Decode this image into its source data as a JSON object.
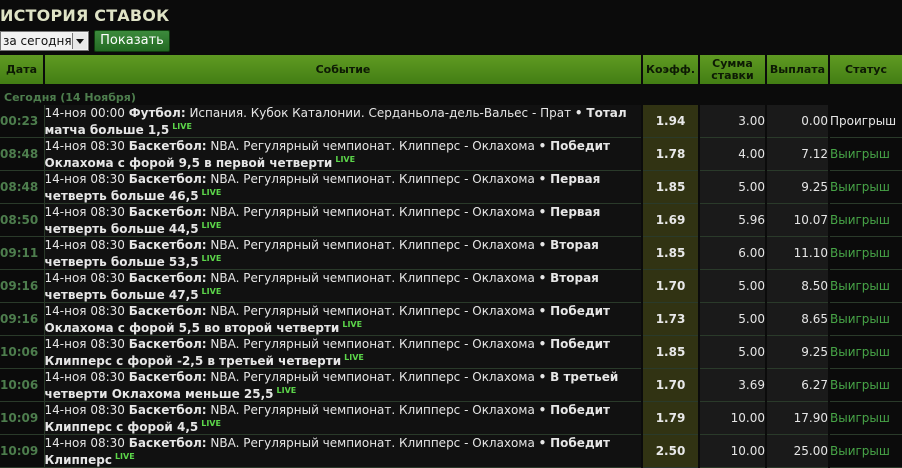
{
  "page_title": "ИСТОРИЯ СТАВОК",
  "filter": {
    "selected": "за сегодня",
    "button": "Показать"
  },
  "columns": {
    "date": "Дата",
    "event": "Событие",
    "coef": "Коэфф.",
    "stake": "Сумма ставки",
    "payout": "Выплата",
    "status": "Статус"
  },
  "group_label": "Сегодня (14 Ноября)",
  "bets": [
    {
      "time": "00:23",
      "date": "14-ноя 00:00",
      "sport": "Футбол:",
      "event": "Испания. Кубок Каталонии. Серданьола-дель-Вальес - Прат",
      "selection": "Тотал матча больше 1,5",
      "live": "LIVE",
      "coef": "1.94",
      "stake": "3.00",
      "payout": "0.00",
      "status": "Проигрыш",
      "won": false
    },
    {
      "time": "08:48",
      "date": "14-ноя 08:30",
      "sport": "Баскетбол:",
      "event": "NBA. Регулярный чемпионат. Клипперс - Оклахома",
      "selection": "Победит Оклахома с форой 9,5 в первой четверти",
      "live": "LIVE",
      "coef": "1.78",
      "stake": "4.00",
      "payout": "7.12",
      "status": "Выигрыш",
      "won": true
    },
    {
      "time": "08:48",
      "date": "14-ноя 08:30",
      "sport": "Баскетбол:",
      "event": "NBA. Регулярный чемпионат. Клипперс - Оклахома",
      "selection": "Первая четверть больше 46,5",
      "live": "LIVE",
      "coef": "1.85",
      "stake": "5.00",
      "payout": "9.25",
      "status": "Выигрыш",
      "won": true
    },
    {
      "time": "08:50",
      "date": "14-ноя 08:30",
      "sport": "Баскетбол:",
      "event": "NBA. Регулярный чемпионат. Клипперс - Оклахома",
      "selection": "Первая четверть больше 44,5",
      "live": "LIVE",
      "coef": "1.69",
      "stake": "5.96",
      "payout": "10.07",
      "status": "Выигрыш",
      "won": true
    },
    {
      "time": "09:11",
      "date": "14-ноя 08:30",
      "sport": "Баскетбол:",
      "event": "NBA. Регулярный чемпионат. Клипперс - Оклахома",
      "selection": "Вторая четверть больше 53,5",
      "live": "LIVE",
      "coef": "1.85",
      "stake": "6.00",
      "payout": "11.10",
      "status": "Выигрыш",
      "won": true
    },
    {
      "time": "09:16",
      "date": "14-ноя 08:30",
      "sport": "Баскетбол:",
      "event": "NBA. Регулярный чемпионат. Клипперс - Оклахома",
      "selection": "Вторая четверть больше 47,5",
      "live": "LIVE",
      "coef": "1.70",
      "stake": "5.00",
      "payout": "8.50",
      "status": "Выигрыш",
      "won": true
    },
    {
      "time": "09:16",
      "date": "14-ноя 08:30",
      "sport": "Баскетбол:",
      "event": "NBA. Регулярный чемпионат. Клипперс - Оклахома",
      "selection": "Победит Оклахома с форой 5,5 во второй четверти",
      "live": "LIVE",
      "coef": "1.73",
      "stake": "5.00",
      "payout": "8.65",
      "status": "Выигрыш",
      "won": true
    },
    {
      "time": "10:06",
      "date": "14-ноя 08:30",
      "sport": "Баскетбол:",
      "event": "NBA. Регулярный чемпионат. Клипперс - Оклахома",
      "selection": "Победит Клипперс с форой -2,5 в третьей четверти",
      "live": "LIVE",
      "coef": "1.85",
      "stake": "5.00",
      "payout": "9.25",
      "status": "Выигрыш",
      "won": true
    },
    {
      "time": "10:06",
      "date": "14-ноя 08:30",
      "sport": "Баскетбол:",
      "event": "NBA. Регулярный чемпионат. Клипперс - Оклахома",
      "selection": "В третьей четверти Оклахома меньше 25,5",
      "live": "LIVE",
      "coef": "1.70",
      "stake": "3.69",
      "payout": "6.27",
      "status": "Выигрыш",
      "won": true
    },
    {
      "time": "10:09",
      "date": "14-ноя 08:30",
      "sport": "Баскетбол:",
      "event": "NBA. Регулярный чемпионат. Клипперс - Оклахома",
      "selection": "Победит Клипперс с форой 4,5",
      "live": "LIVE",
      "coef": "1.79",
      "stake": "10.00",
      "payout": "17.90",
      "status": "Выигрыш",
      "won": true
    },
    {
      "time": "10:09",
      "date": "14-ноя 08:30",
      "sport": "Баскетбол:",
      "event": "NBA. Регулярный чемпионат. Клипперс - Оклахома",
      "selection": "Победит Клипперс",
      "live": "LIVE",
      "coef": "2.50",
      "stake": "10.00",
      "payout": "25.00",
      "status": "Выигрыш",
      "won": true
    }
  ],
  "colors": {
    "header_green": "#4f8a1a",
    "status_won": "#47a447",
    "coef_bg": "#313313"
  }
}
